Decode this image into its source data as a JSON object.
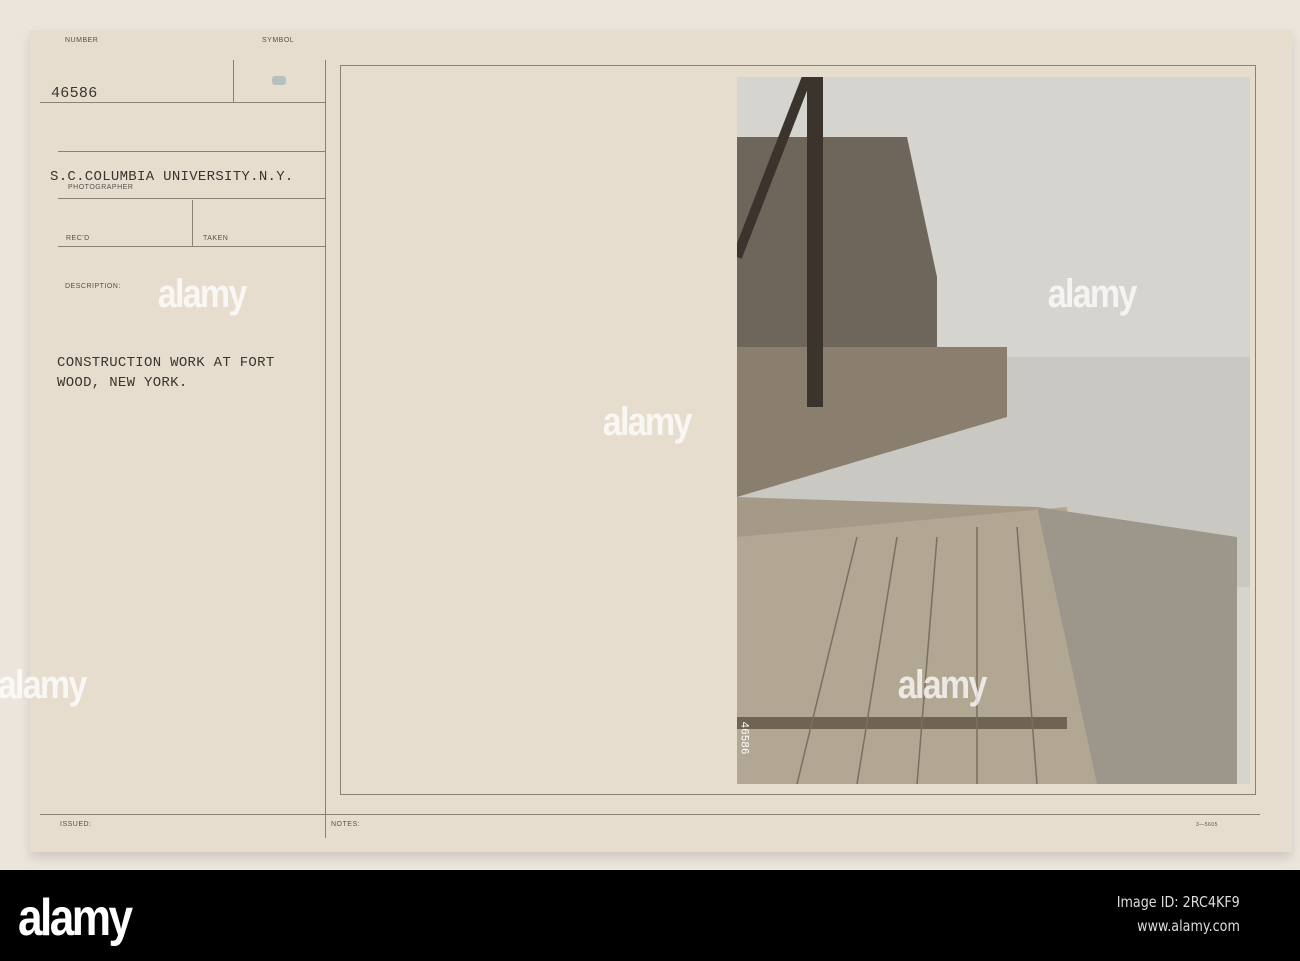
{
  "card": {
    "number_label": "NUMBER",
    "number_value": "46586",
    "symbol_label": "SYMBOL",
    "photographer_value": "S.C.COLUMBIA UNIVERSITY.N.Y.",
    "photographer_label": "PHOTOGRAPHER",
    "recd_label": "REC'D",
    "taken_label": "TAKEN",
    "description_label": "DESCRIPTION:",
    "description_line1": "CONSTRUCTION WORK AT FORT",
    "description_line2": "WOOD, NEW YORK.",
    "issued_label": "ISSUED:",
    "notes_label": "NOTES:",
    "form_code": "3—5605",
    "photo_number": "46586"
  },
  "watermark": "alamy",
  "footer": {
    "logo": "alamy",
    "image_id": "Image ID: 2RC4KF9",
    "url": "www.alamy.com"
  }
}
